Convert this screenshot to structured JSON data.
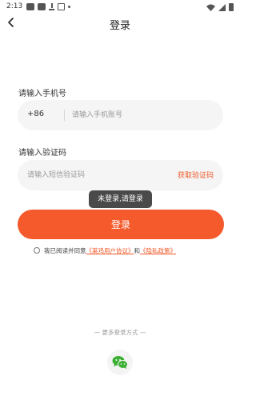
{
  "status_bar": {
    "time": "2:13"
  },
  "header": {
    "title": "登录"
  },
  "phone": {
    "label": "请输入手机号",
    "country_code": "+86",
    "placeholder": "请输入手机账号"
  },
  "code": {
    "label": "请输入验证码",
    "placeholder": "请输入短信验证码",
    "get_code_label": "获取验证码"
  },
  "toast": "未登录,请登录",
  "login_button": "登录",
  "agreement": {
    "prefix": "我已阅读并同意",
    "user_agreement": "《莱鸡用户协议》",
    "and": "和",
    "privacy_policy": "《隐私政策》",
    "checked": false
  },
  "more_login": "— 更多登录方式 —",
  "icons": {
    "back": "back-arrow-icon",
    "wechat": "wechat-icon",
    "radio": "radio-unchecked-icon"
  },
  "colors": {
    "accent": "#f45a2c",
    "link": "#f05a2a",
    "wechat": "#3cb034",
    "field_bg": "#f5f5f5",
    "toast_bg": "#4a4a4a"
  }
}
